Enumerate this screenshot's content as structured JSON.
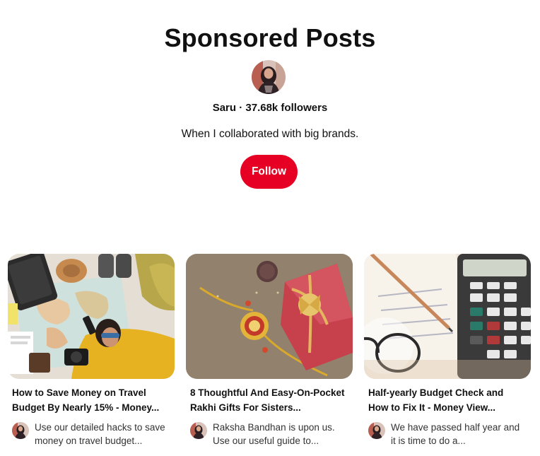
{
  "board": {
    "title": "Sponsored Posts",
    "owner_line": "Saru · 37.68k followers",
    "description": "When I collaborated with big brands.",
    "follow_label": "Follow"
  },
  "colors": {
    "accent": "#e60023"
  },
  "pins": [
    {
      "title_line1": "How to Save Money on Travel",
      "title_line2": "Budget By Nearly 15% - Money...",
      "desc_line1": "Use our detailed hacks to save",
      "desc_line2": "money on travel budget..."
    },
    {
      "title_line1": "8 Thoughtful And Easy-On-Pocket",
      "title_line2": "Rakhi Gifts For Sisters...",
      "desc_line1": "Raksha Bandhan is upon us.",
      "desc_line2": "Use our useful guide to..."
    },
    {
      "title_line1": "Half-yearly Budget Check and",
      "title_line2": "How to Fix It - Money View...",
      "desc_line1": "We have passed half year and",
      "desc_line2": "it is time to do a..."
    }
  ]
}
